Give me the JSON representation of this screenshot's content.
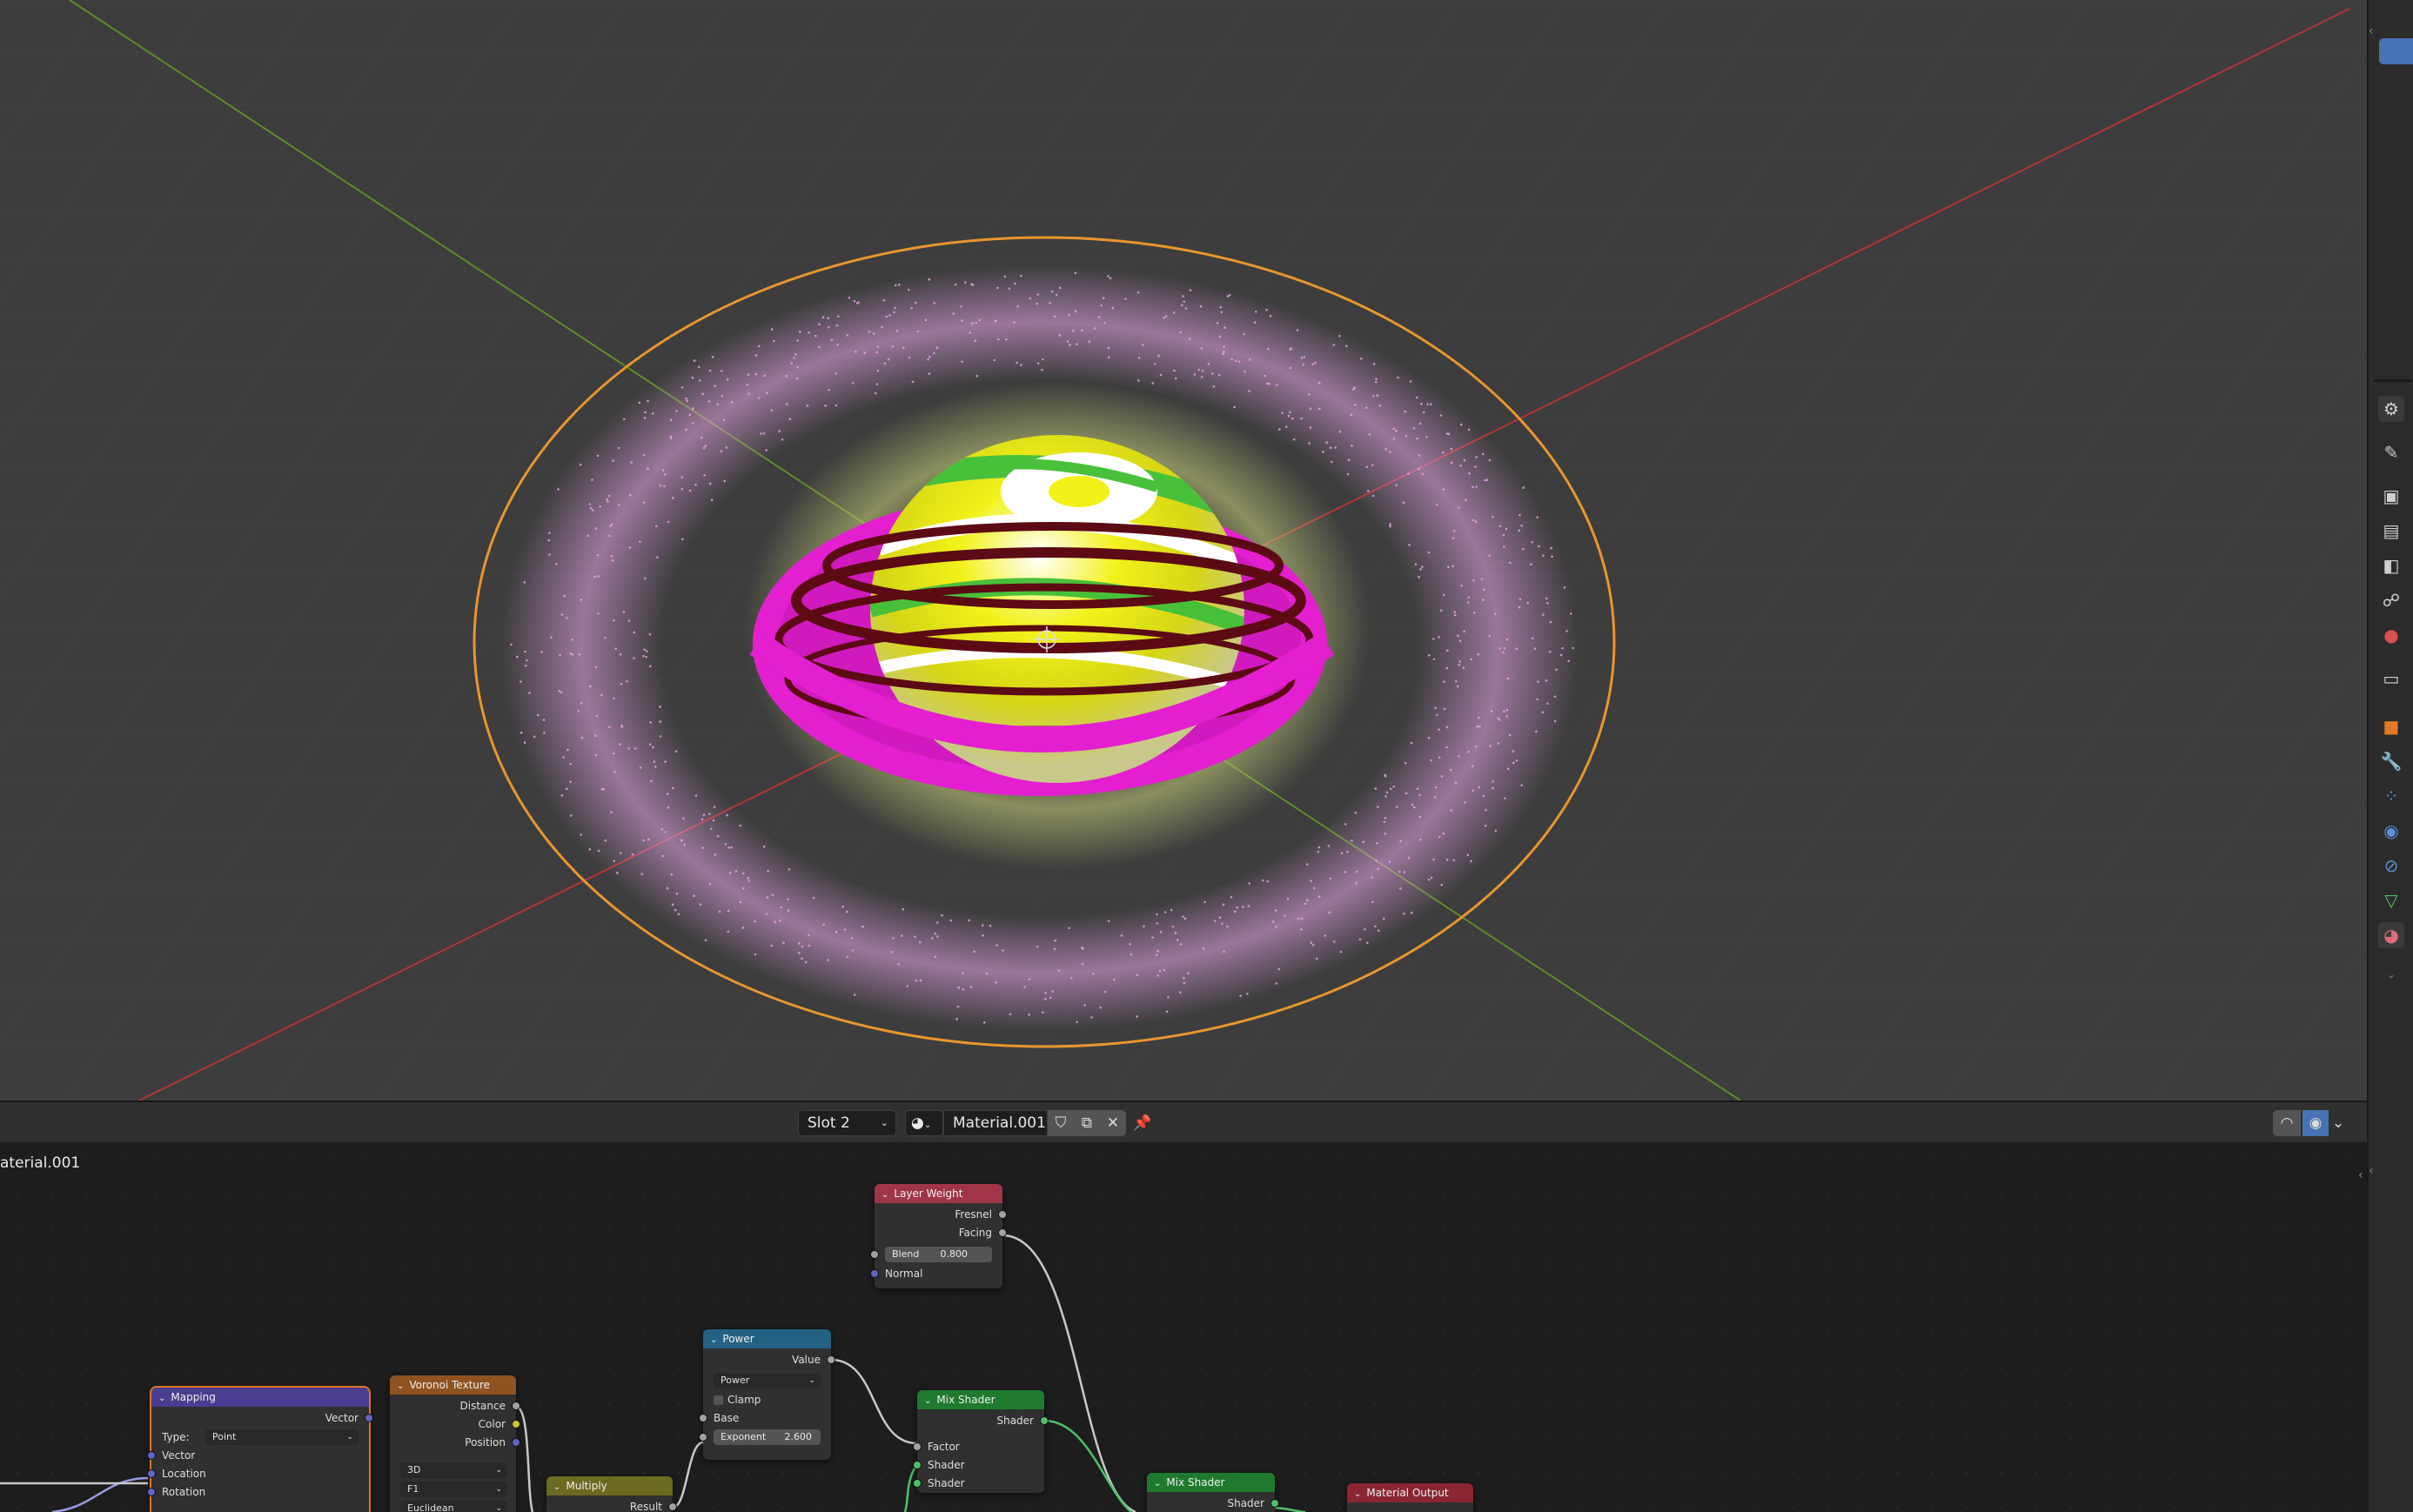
{
  "node_editor": {
    "slot": "Slot 2",
    "material_name": "Material.001",
    "breadcrumb": "aterial.001"
  },
  "nodes": {
    "layer_weight": {
      "title": "Layer Weight",
      "out_fresnel": "Fresnel",
      "out_facing": "Facing",
      "blend_label": "Blend",
      "blend_value": "0.800",
      "in_normal": "Normal"
    },
    "power": {
      "title": "Power",
      "out_value": "Value",
      "op": "Power",
      "clamp": "Clamp",
      "in_base": "Base",
      "exponent_label": "Exponent",
      "exponent_value": "2.600"
    },
    "mix_shader_1": {
      "title": "Mix Shader",
      "out_shader": "Shader",
      "in_factor": "Factor",
      "in_shader_a": "Shader",
      "in_shader_b": "Shader"
    },
    "mix_shader_2": {
      "title": "Mix Shader",
      "out_shader": "Shader"
    },
    "material_output": {
      "title": "Material Output"
    },
    "mapping": {
      "title": "Mapping",
      "out_vector": "Vector",
      "type_label": "Type:",
      "type_value": "Point",
      "in_vector": "Vector",
      "in_location": "Location",
      "in_rotation": "Rotation"
    },
    "voronoi": {
      "title": "Voronoi Texture",
      "out_distance": "Distance",
      "out_color": "Color",
      "out_position": "Position",
      "dim": "3D",
      "feature": "F1",
      "metric": "Euclidean"
    },
    "multiply": {
      "title": "Multiply",
      "out_result": "Result"
    }
  },
  "colors": {
    "viewport_bg": "#3d3d3d",
    "selection_outline": "#e8962e",
    "ring_magenta": "#e41fd0",
    "sphere_yellow": "#f2f21a",
    "sphere_green": "#49c03a",
    "particles_pink": "#e6a6e6",
    "glow_yellowgreen": "#c9d27a",
    "axis_x": "#b8333a",
    "axis_y": "#5e8a26"
  },
  "icons": [
    "tool-icon",
    "render-icon",
    "output-icon",
    "view-layer-icon",
    "scene-icon",
    "world-icon",
    "collection-icon",
    "object-icon",
    "modifier-icon",
    "particles-icon",
    "physics-icon",
    "constraints-icon",
    "data-icon",
    "material-icon"
  ]
}
